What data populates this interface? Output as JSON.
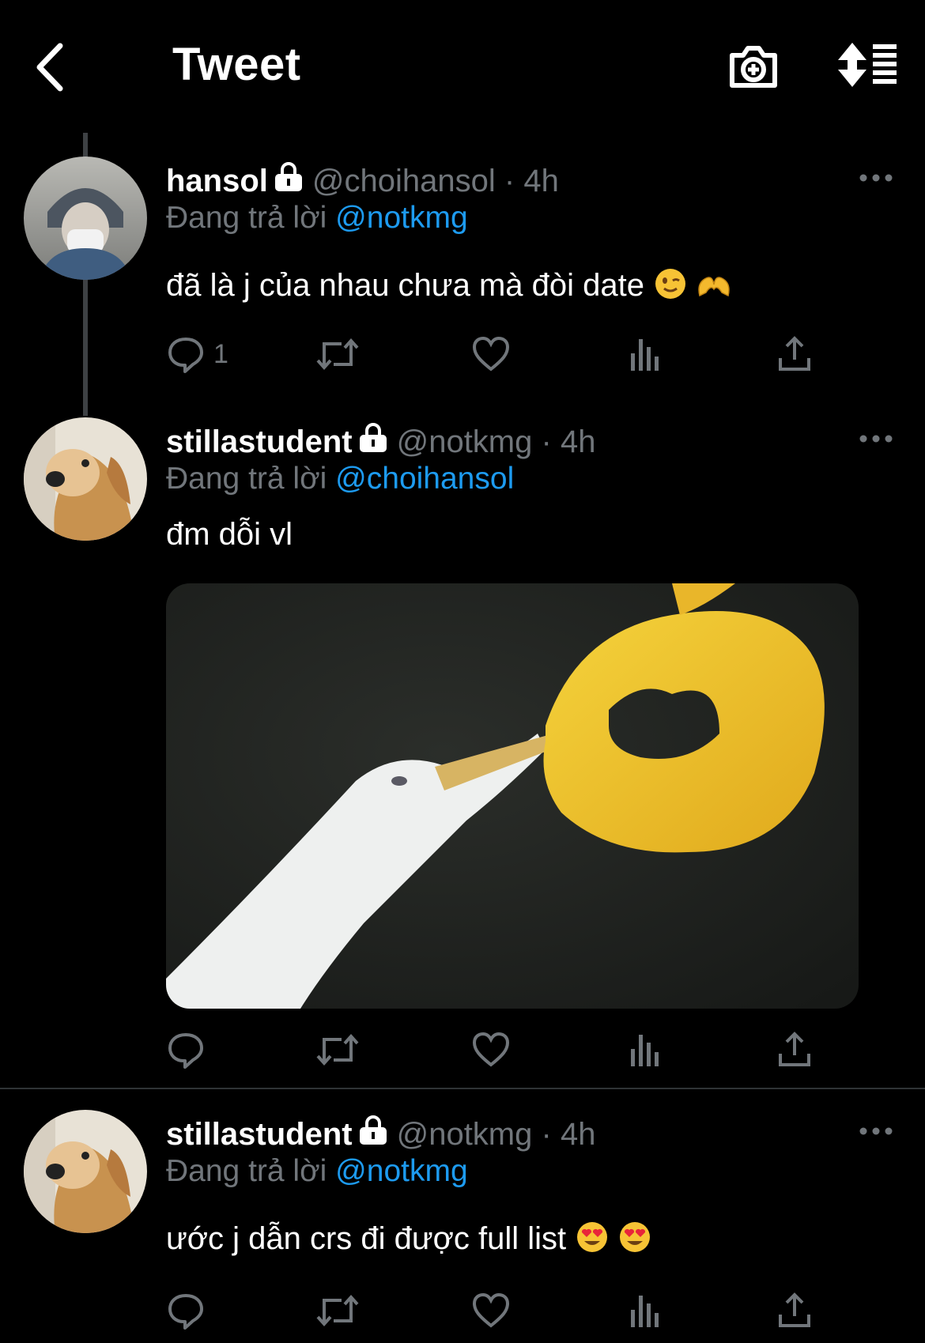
{
  "header": {
    "title": "Tweet"
  },
  "tweets": [
    {
      "name": "hansol",
      "handle": "@choihansol",
      "dot": "·",
      "time": "4h",
      "replying_prefix": "Đang trả lời",
      "replying_to": "@notkmg",
      "text": "đã là j của nhau chưa mà đòi date",
      "reply_count": "1"
    },
    {
      "name": "stillastudent",
      "handle": "@notkmg",
      "dot": "·",
      "time": "4h",
      "replying_prefix": "Đang trả lời",
      "replying_to": "@choihansol",
      "text": "đm dỗi vl"
    },
    {
      "name": "stillastudent",
      "handle": "@notkmg",
      "dot": "·",
      "time": "4h",
      "replying_prefix": "Đang trả lời",
      "replying_to": "@notkmg",
      "text": "ước j dẫn crs đi được full list"
    }
  ],
  "colors": {
    "accent": "#1d9bf0",
    "muted": "#71767b",
    "background": "#000000"
  },
  "icons": [
    "back-arrow-icon",
    "camera-plus-icon",
    "sort-icon",
    "lock-icon",
    "more-icon",
    "reply-icon",
    "retweet-icon",
    "like-icon",
    "views-icon",
    "share-icon"
  ]
}
